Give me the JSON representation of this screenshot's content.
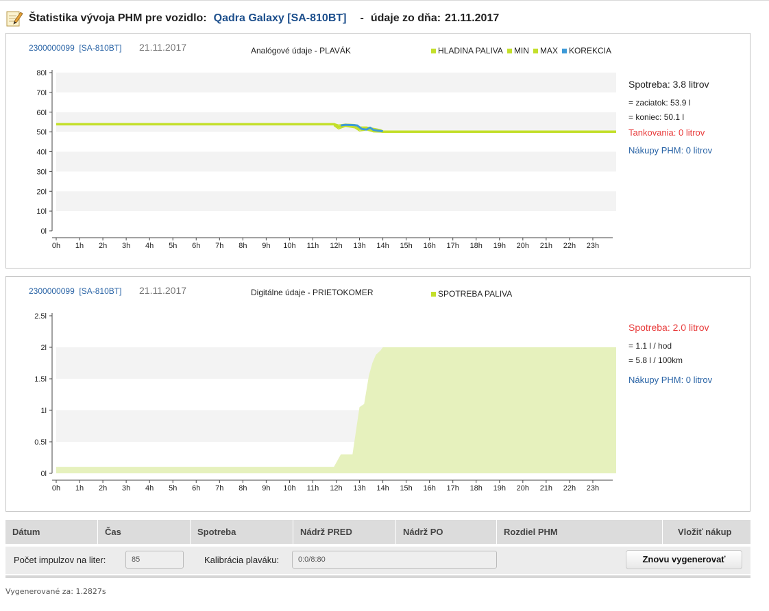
{
  "header": {
    "title": "Štatistika vývoja PHM pre vozidlo:",
    "vehicle": "Qadra Galaxy [SA-810BT]",
    "sep": "-",
    "date_label": "údaje zo dňa:",
    "date": "21.11.2017",
    "icon": "note-pencil-icon"
  },
  "panel1": {
    "id": "2300000099",
    "plate": "[SA-810BT]",
    "date": "21.11.2017",
    "title": "Analógové údaje - PLAVÁK",
    "legend": [
      {
        "label": "HLADINA PALIVA",
        "color": "#c3df2a"
      },
      {
        "label": "MIN",
        "color": "#c3df2a"
      },
      {
        "label": "MAX",
        "color": "#c3df2a"
      },
      {
        "label": "KOREKCIA",
        "color": "#3d9ad8"
      }
    ],
    "side": {
      "spotreba": "Spotreba: 3.8 litrov",
      "zaciatok": "= zaciatok: 53.9 l",
      "koniec": "= koniec: 50.1 l",
      "tankovania": "Tankovania: 0 litrov",
      "nakupy": "Nákupy PHM: 0 litrov"
    }
  },
  "panel2": {
    "id": "2300000099",
    "plate": "[SA-810BT]",
    "date": "21.11.2017",
    "title": "Digitálne údaje - PRIETOKOMER",
    "legend": [
      {
        "label": "SPOTREBA PALIVA",
        "color": "#c3df2a"
      }
    ],
    "side": {
      "spotreba": "Spotreba: 2.0 litrov",
      "hod": "= 1.1 l / hod",
      "km": "= 5.8 l / 100km",
      "nakupy": "Nákupy PHM: 0 litrov"
    }
  },
  "chart_data": [
    {
      "type": "line",
      "title": "Analógové údaje - PLAVÁK",
      "ylim": [
        0,
        80
      ],
      "yticks": [
        "80l",
        "70l",
        "60l",
        "50l",
        "40l",
        "30l",
        "20l",
        "10l",
        "0l"
      ],
      "ytick_values": [
        80,
        70,
        60,
        50,
        40,
        30,
        20,
        10,
        0
      ],
      "xlim": [
        0,
        24
      ],
      "xticks": [
        "0h",
        "1h",
        "2h",
        "3h",
        "4h",
        "5h",
        "6h",
        "7h",
        "8h",
        "9h",
        "10h",
        "11h",
        "12h",
        "13h",
        "14h",
        "15h",
        "16h",
        "17h",
        "18h",
        "19h",
        "20h",
        "21h",
        "22h",
        "23h"
      ],
      "grid": "horizontal bands",
      "legend_position": "top",
      "series": [
        {
          "name": "HLADINA PALIVA",
          "color": "#c3df2a",
          "x": [
            0,
            11.9,
            12.1,
            12.4,
            12.8,
            13.0,
            13.3,
            13.6,
            13.9,
            14.0,
            24
          ],
          "y": [
            53.9,
            53.9,
            52.5,
            53.5,
            53.0,
            51.5,
            51.8,
            50.8,
            50.6,
            50.1,
            50.1
          ]
        },
        {
          "name": "MIN",
          "color": "#c3df2a",
          "x": [
            11.9,
            12.1,
            12.4,
            12.8,
            13.0,
            13.3,
            13.6,
            13.9,
            14.0
          ],
          "y": [
            53.2,
            51.5,
            52.8,
            52.0,
            50.5,
            51.0,
            50.0,
            49.9,
            49.8
          ]
        },
        {
          "name": "MAX",
          "color": "#c3df2a",
          "x": [
            11.9,
            12.1,
            12.4,
            12.8,
            13.0,
            13.3,
            13.6,
            13.9,
            14.0
          ],
          "y": [
            54.3,
            53.5,
            54.0,
            53.8,
            52.5,
            52.5,
            51.8,
            51.2,
            50.6
          ]
        },
        {
          "name": "KOREKCIA",
          "color": "#3d9ad8",
          "x": [
            12.2,
            12.4,
            12.7,
            12.9,
            13.1,
            13.3,
            13.45,
            13.6,
            13.8,
            14.0
          ],
          "y": [
            53.3,
            53.6,
            53.5,
            53.3,
            51.5,
            51.2,
            52.2,
            51.0,
            50.6,
            50.4
          ]
        }
      ]
    },
    {
      "type": "area",
      "title": "Digitálne údaje - PRIETOKOMER",
      "ylim": [
        0,
        2.5
      ],
      "yticks": [
        "2.5l",
        "2l",
        "1.5l",
        "1l",
        "0.5l",
        "0l"
      ],
      "ytick_values": [
        2.5,
        2,
        1.5,
        1,
        0.5,
        0
      ],
      "xlim": [
        0,
        24
      ],
      "xticks": [
        "0h",
        "1h",
        "2h",
        "3h",
        "4h",
        "5h",
        "6h",
        "7h",
        "8h",
        "9h",
        "10h",
        "11h",
        "12h",
        "13h",
        "14h",
        "15h",
        "16h",
        "17h",
        "18h",
        "19h",
        "20h",
        "21h",
        "22h",
        "23h"
      ],
      "legend_position": "top",
      "series": [
        {
          "name": "SPOTREBA PALIVA",
          "color": "#c3df2a",
          "x": [
            0,
            11.9,
            12.2,
            12.7,
            13.0,
            13.2,
            13.4,
            13.55,
            13.7,
            13.9,
            14.0,
            24
          ],
          "y": [
            0.1,
            0.1,
            0.3,
            0.3,
            1.05,
            1.1,
            1.55,
            1.75,
            1.88,
            1.95,
            2.0,
            2.0
          ]
        }
      ]
    }
  ],
  "table": {
    "headers": [
      "Dátum",
      "Čas",
      "Spotreba",
      "Nádrž PRED",
      "Nádrž PO",
      "Rozdiel PHM",
      "Vložiť nákup"
    ]
  },
  "controls": {
    "impulse_label": "Počet impulzov na liter:",
    "impulse_value": "85",
    "calib_label": "Kalibrácia plaváku:",
    "calib_value": "0:0/8:80",
    "regen_button": "Znovu vygenerovať"
  },
  "footer": "Vygenerované za: 1.2827s"
}
